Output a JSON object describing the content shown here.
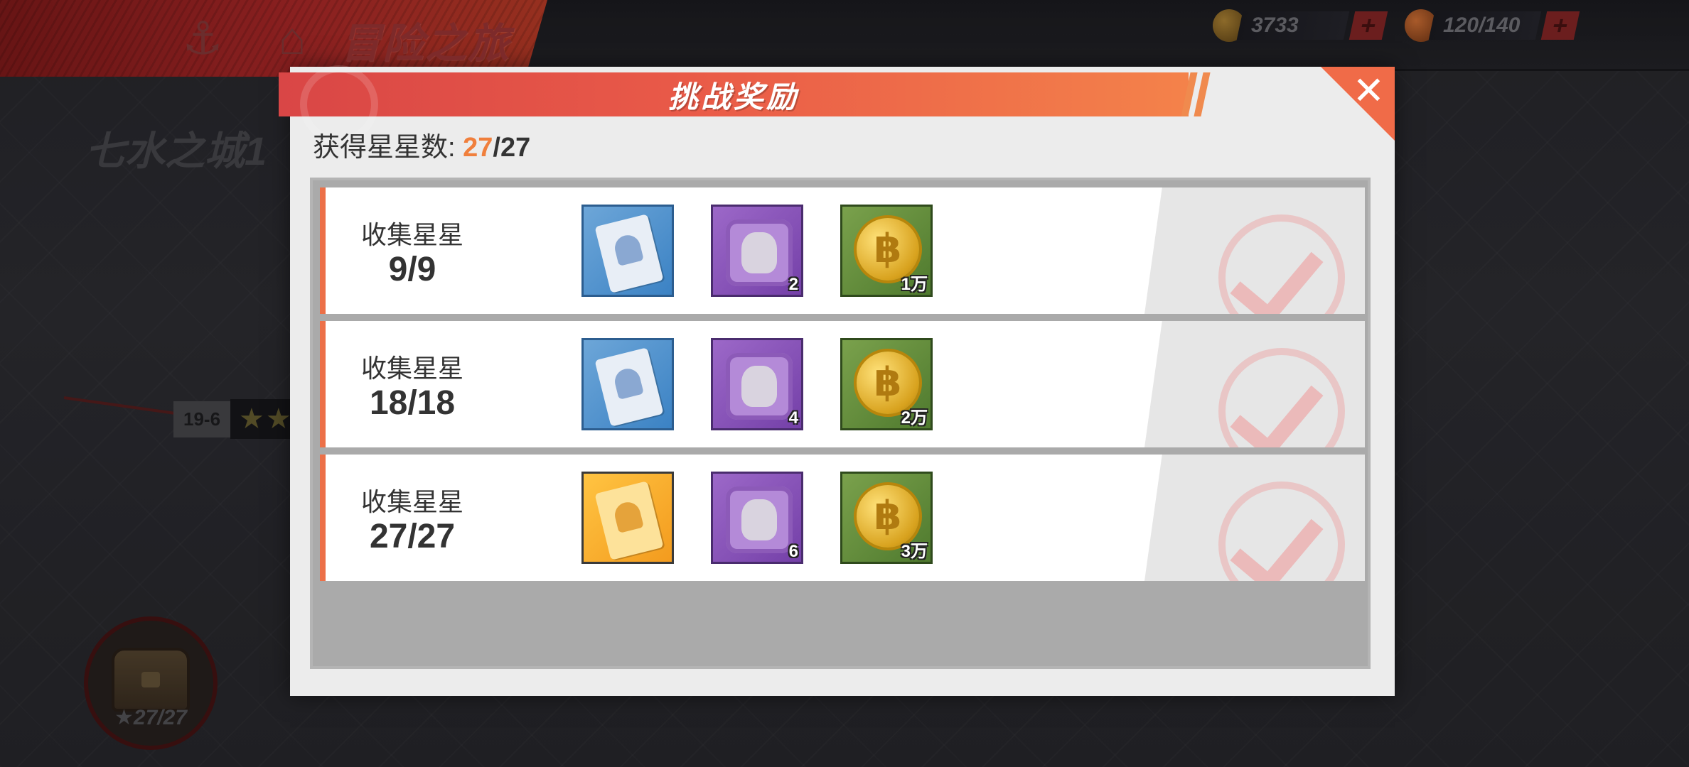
{
  "header": {
    "title": "冒险之旅",
    "back_icon": "anchor-back-icon",
    "home_icon": "home-icon"
  },
  "resources": [
    {
      "name": "gold-resource",
      "value": "3733",
      "icon": "coin-bag-icon"
    },
    {
      "name": "stamina-resource",
      "value": "120/140",
      "icon": "meat-icon"
    }
  ],
  "map": {
    "stage_title": "七水之城1",
    "stage_node_label": "19-6",
    "stage_node_stars": "★★",
    "chest_label": "★27/27"
  },
  "dialog": {
    "title": "挑战奖励",
    "close_icon": "close-icon",
    "stars_label": "获得星星数:",
    "stars_got": "27",
    "stars_total": "/27",
    "rows": [
      {
        "label": "收集星星",
        "progress": "9/9",
        "items": [
          {
            "type": "ticket-blue",
            "qty": ""
          },
          {
            "type": "puzzle",
            "qty": "2"
          },
          {
            "type": "coin",
            "qty": "1万"
          }
        ],
        "claimed": true
      },
      {
        "label": "收集星星",
        "progress": "18/18",
        "items": [
          {
            "type": "ticket-blue",
            "qty": ""
          },
          {
            "type": "puzzle",
            "qty": "4"
          },
          {
            "type": "coin",
            "qty": "2万"
          }
        ],
        "claimed": true
      },
      {
        "label": "收集星星",
        "progress": "27/27",
        "items": [
          {
            "type": "ticket-gold",
            "qty": ""
          },
          {
            "type": "puzzle",
            "qty": "6"
          },
          {
            "type": "coin",
            "qty": "3万"
          }
        ],
        "claimed": true
      }
    ]
  },
  "colors": {
    "accent": "#f07f3c",
    "header_red": "#d94646",
    "header_orange": "#f4824a"
  }
}
